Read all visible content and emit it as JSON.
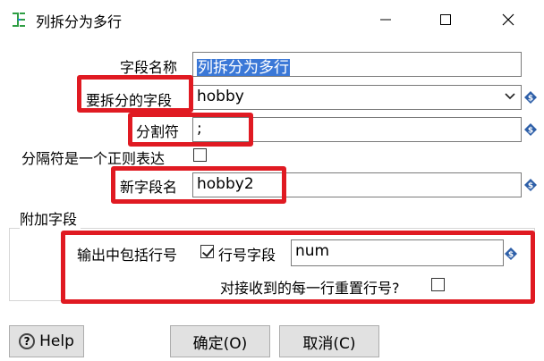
{
  "window": {
    "title": "列拆分为多行",
    "icon": "split-rows-icon"
  },
  "form": {
    "field_name_label": "字段名称",
    "field_name_value": "列拆分为多行",
    "split_field_label": "要拆分的字段",
    "split_field_value": "hobby",
    "delimiter_label": "分割符",
    "delimiter_value": ";",
    "regex_label": "分隔符是一个正则表达",
    "regex_checked": false,
    "new_field_label": "新字段名",
    "new_field_value": "hobby2"
  },
  "extra": {
    "group_title": "附加字段",
    "include_rownum_label": "输出中包括行号",
    "include_rownum_checked": true,
    "rownum_field_label": "行号字段",
    "rownum_field_value": "num",
    "reset_rownum_label": "对接收到的每一行重置行号?",
    "reset_rownum_checked": false
  },
  "buttons": {
    "help": "Help",
    "ok": "确定(O)",
    "cancel": "取消(C)"
  },
  "colors": {
    "highlight": "#e01a22",
    "selection": "#3b78d7",
    "variable_icon": "#2d5fa8"
  }
}
